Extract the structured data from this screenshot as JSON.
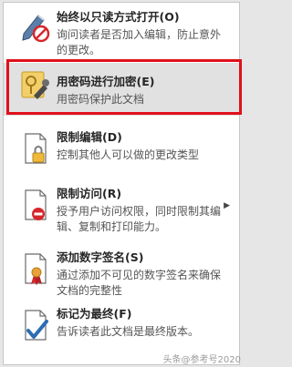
{
  "menu": {
    "items": [
      {
        "title": "始终以只读方式打开(O)",
        "desc": "询问读者是否加入编辑，防止意外的更改。",
        "icon": "pen-prohibited-icon"
      },
      {
        "title": "用密码进行加密(E)",
        "desc": "用密码保护此文档",
        "icon": "lock-key-icon"
      },
      {
        "title": "限制编辑(D)",
        "desc": "控制其他人可以做的更改类型",
        "icon": "document-lock-icon"
      },
      {
        "title": "限制访问(R)",
        "desc": "授予用户访问权限，同时限制其编辑、复制和打印能力。",
        "icon": "document-restricted-icon"
      },
      {
        "title": "添加数字签名(S)",
        "desc": "通过添加不可见的数字签名来确保文档的完整性",
        "icon": "document-ribbon-icon"
      },
      {
        "title": "标记为最终(F)",
        "desc": "告诉读者此文档是最终版本。",
        "icon": "document-check-icon"
      }
    ]
  },
  "watermark": "头条@参考号2020",
  "colors": {
    "highlight_border": "#e0101a",
    "accent_red": "#d7262b",
    "accent_blue": "#2b6cb3"
  }
}
